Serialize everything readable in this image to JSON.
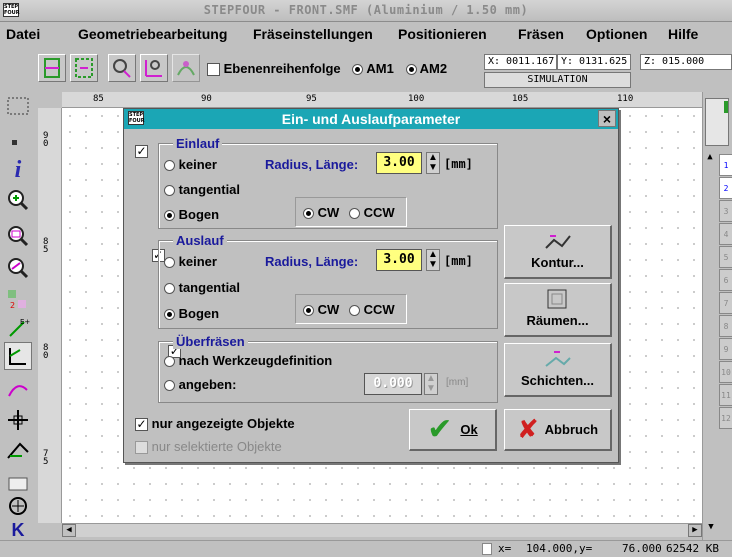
{
  "window": {
    "title": "STEPFOUR - FRONT.SMF (Aluminium / 1.50 mm)",
    "app_icon": "STEP FOUR"
  },
  "menu": [
    {
      "label": "Datei"
    },
    {
      "label": "Geometriebearbeitung"
    },
    {
      "label": "Fräseinstellungen"
    },
    {
      "label": "Positionieren"
    },
    {
      "label": "Fräsen"
    },
    {
      "label": "Optionen"
    },
    {
      "label": "Hilfe"
    }
  ],
  "toolbar": {
    "ebenen_label": "Ebenenreihenfolge",
    "am1_label": "AM1",
    "am2_label": "AM2",
    "x_coord": "X: 0011.167",
    "y_coord": "Y: 0131.625",
    "z_coord": "Z: 015.000",
    "simulation_label": "SIMULATION"
  },
  "ruler": {
    "ticks": [
      "85",
      "90",
      "95",
      "100",
      "105",
      "110"
    ]
  },
  "vruler": {
    "ticks": [
      "9\n0",
      "8\n5",
      "8\n0",
      "7\n5"
    ]
  },
  "dialog": {
    "title": "Ein- und Auslaufparameter",
    "close": "×",
    "einlauf": {
      "title": "Einlauf",
      "keiner": "keiner",
      "tangential": "tangential",
      "bogen": "Bogen",
      "radius_label": "Radius, Länge:",
      "value": "3.00",
      "unit": "[mm]",
      "cw": "CW",
      "ccw": "CCW"
    },
    "auslauf": {
      "title": "Auslauf",
      "keiner": "keiner",
      "tangential": "tangential",
      "bogen": "Bogen",
      "radius_label": "Radius, Länge:",
      "value": "3.00",
      "unit": "[mm]",
      "cw": "CW",
      "ccw": "CCW"
    },
    "ueberfraesen": {
      "title": "Überfräsen",
      "nach": "nach Werkzeugdefinition",
      "angeben": "angeben:",
      "value": "0.000",
      "unit": "[mm]"
    },
    "nur_angezeigte": "nur angezeigte Objekte",
    "nur_selektierte": "nur selektierte Objekte",
    "buttons": {
      "kontur": "Kontur...",
      "raeumen": "Räumen...",
      "schichten": "Schichten...",
      "ok": "Ok",
      "abbruch": "Abbruch"
    },
    "colors": {
      "title_bar": "#1ba6b5",
      "value_field": "#ffff80",
      "group_label": "#1a1a9c"
    }
  },
  "right_tabs": [
    "1",
    "2",
    "3",
    "4",
    "5",
    "6",
    "7",
    "8",
    "9",
    "10",
    "11",
    "12"
  ],
  "status": {
    "x_label": "x=",
    "x_value": "104.000,y=",
    "y_value": "76.000",
    "memory": "62542 KB"
  },
  "icons": [
    "window-icon",
    "select-icon",
    "info-icon",
    "zoom-in-icon",
    "zoom-window-icon",
    "zoom-out-icon",
    "layer-icon",
    "move-icon",
    "tool-path-icon",
    "crosshair-icon",
    "k-icon"
  ]
}
